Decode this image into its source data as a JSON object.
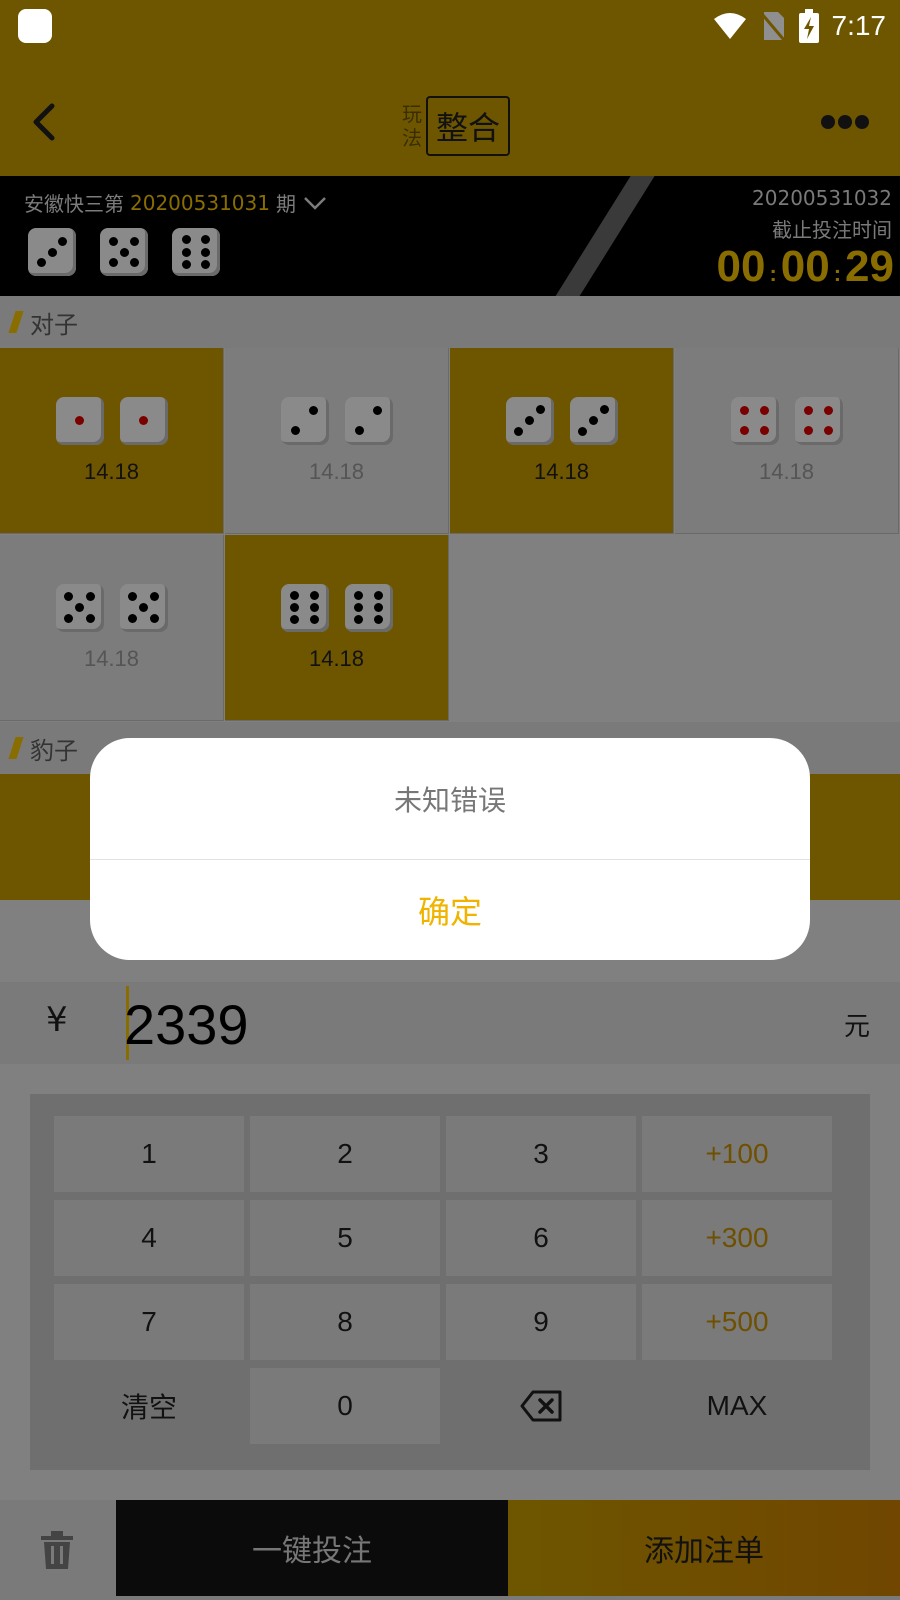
{
  "status_bar": {
    "time": "7:17"
  },
  "header": {
    "play_mode_label": "玩法",
    "play_mode_value": "整合"
  },
  "info": {
    "lottery_name": "安徽快三第",
    "issue_number": "20200531031",
    "issue_suffix": "期",
    "last_result": [
      3,
      5,
      6
    ],
    "next_issue": "20200531032",
    "deadline_label": "截止投注时间",
    "countdown": {
      "hh": "00",
      "mm": "00",
      "ss": "29"
    }
  },
  "pairs_section": {
    "title": "对子",
    "items": [
      {
        "face": 1,
        "odds": "14.18",
        "selected": true
      },
      {
        "face": 2,
        "odds": "14.18",
        "selected": false
      },
      {
        "face": 3,
        "odds": "14.18",
        "selected": true
      },
      {
        "face": 4,
        "odds": "14.18",
        "selected": false
      },
      {
        "face": 5,
        "odds": "14.18",
        "selected": false
      },
      {
        "face": 6,
        "odds": "14.18",
        "selected": true
      }
    ]
  },
  "triples_section": {
    "title": "豹子"
  },
  "amount": {
    "currency": "¥",
    "value": "2339",
    "unit": "元"
  },
  "keypad": {
    "keys": [
      "1",
      "2",
      "3",
      "+100",
      "4",
      "5",
      "6",
      "+300",
      "7",
      "8",
      "9",
      "+500",
      "清空",
      "0",
      "",
      "MAX"
    ]
  },
  "bottom": {
    "quick_bet": "一键投注",
    "add_to_slip": "添加注单"
  },
  "dialog": {
    "message": "未知错误",
    "confirm": "确定"
  },
  "colors": {
    "accent": "#f0b400",
    "overlay_header": "#6e5600",
    "dialog_bg": "#ffffff"
  }
}
